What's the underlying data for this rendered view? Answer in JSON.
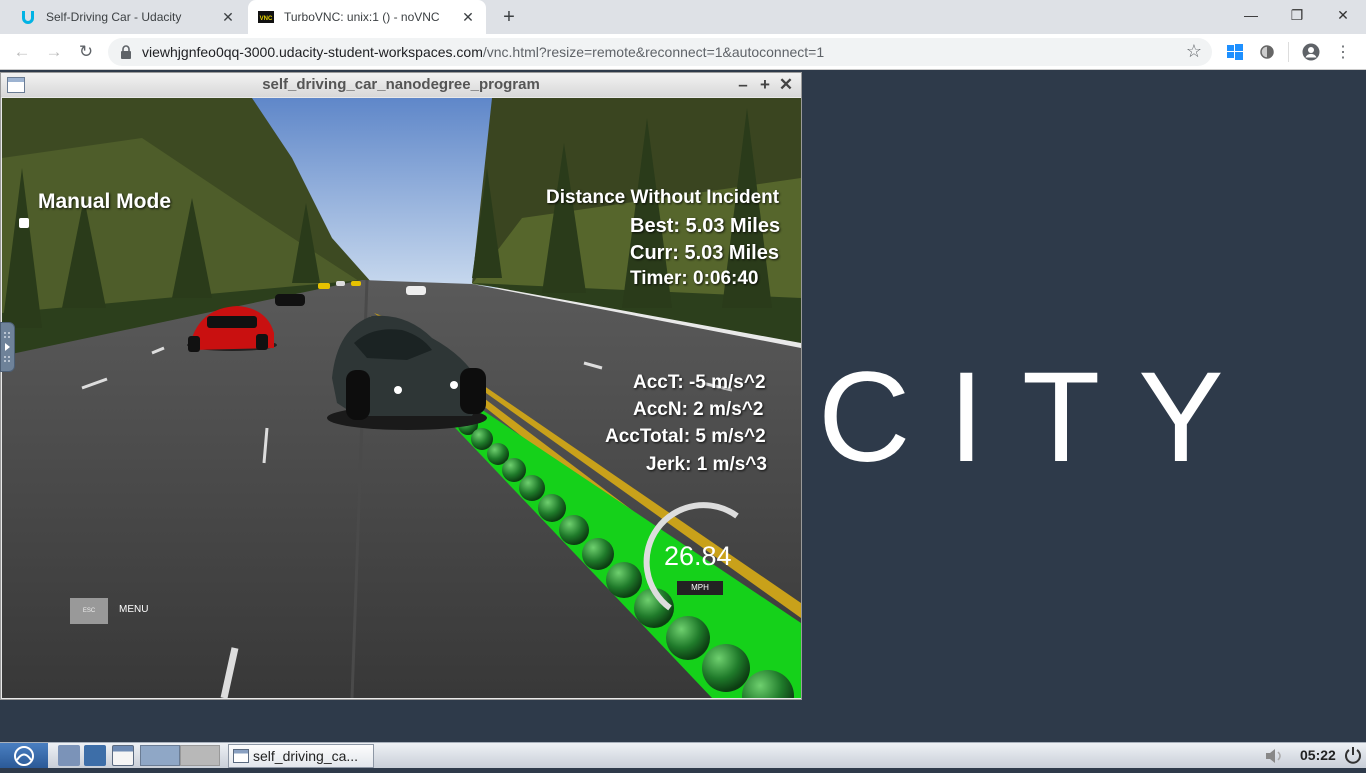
{
  "browser": {
    "tabs": [
      {
        "label": "Self-Driving Car - Udacity",
        "icon": "udacity-logo-icon",
        "active": false
      },
      {
        "label": "TurboVNC: unix:1 () - noVNC",
        "icon": "vnc-icon",
        "active": true
      }
    ],
    "url_host": "viewhjgnfeo0qq-3000.udacity-student-workspaces.com",
    "url_path": "/vnc.html?resize=remote&reconnect=1&autoconnect=1"
  },
  "desktop": {
    "wallpaper_text": "CITY",
    "wallpaper_color": "#2e3a4a",
    "taskbar": {
      "task_label": "self_driving_ca...",
      "clock": "05:22"
    }
  },
  "simulator": {
    "window_title": "self_driving_car_nanodegree_program",
    "mode_label": "Manual Mode",
    "distance_heading": "Distance Without Incident",
    "best": "Best: 5.03 Miles",
    "curr": "Curr: 5.03 Miles",
    "timer": "Timer: 0:06:40",
    "acc_t": "AccT: -5 m/s^2",
    "acc_n": "AccN: 2 m/s^2",
    "acc_total": "AccTotal: 5 m/s^2",
    "jerk": "Jerk: 1 m/s^3",
    "speed": "26.84",
    "speed_unit": "MPH",
    "esc_label": "ESC",
    "menu_label": "MENU",
    "path_color": "#15d11a"
  }
}
